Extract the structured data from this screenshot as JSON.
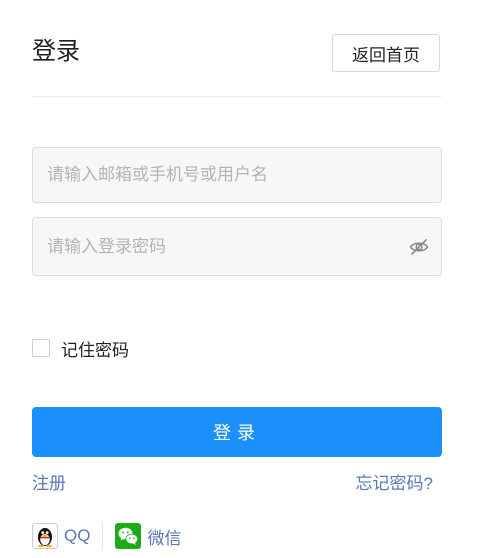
{
  "header": {
    "title": "登录",
    "back_label": "返回首页"
  },
  "form": {
    "account_placeholder": "请输入邮箱或手机号或用户名",
    "account_value": "",
    "password_placeholder": "请输入登录密码",
    "password_value": "",
    "remember_label": "记住密码",
    "remember_checked": false,
    "submit_label": "登录"
  },
  "links": {
    "register": "注册",
    "forgot": "忘记密码?"
  },
  "social": {
    "qq_label": "QQ",
    "wechat_label": "微信"
  },
  "colors": {
    "primary": "#1b8ffa",
    "link": "#5b77b4",
    "input_bg": "#f7f7f7",
    "wechat": "#1aad19"
  },
  "icons": {
    "password_toggle": "eye-slash-icon",
    "qq": "qq-penguin-icon",
    "wechat": "wechat-icon"
  }
}
